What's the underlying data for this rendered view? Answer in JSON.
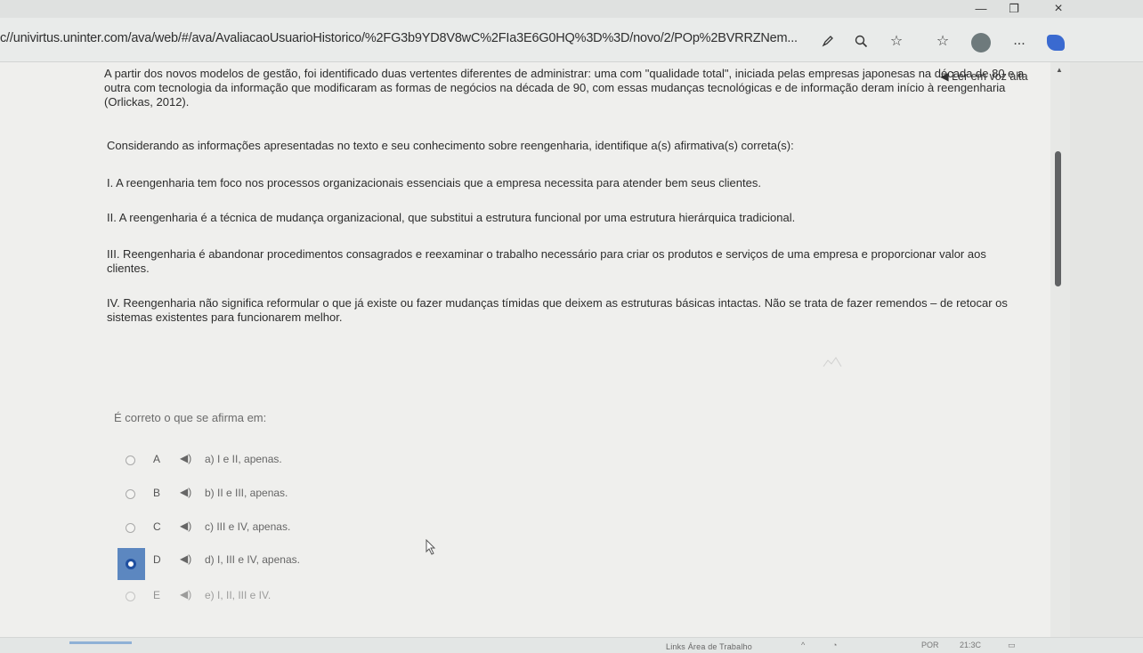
{
  "browser": {
    "url": "c//univirtus.uninter.com/ava/web/#/ava/AvaliacaoUsuarioHistorico/%2FG3b9YD8V8wC%2FIa3E6G0HQ%3D%3D/novo/2/POp%2BVRRZNem...",
    "icons": [
      "pen-icon",
      "zoom-icon",
      "favorite-star-icon",
      "favorites-list-icon",
      "profile-avatar",
      "more-icon",
      "extension-icon"
    ],
    "more_label": "..."
  },
  "tts_label": "◀ Ler em voz alta",
  "question": {
    "intro": "A partir dos novos modelos de gestão, foi identificado duas vertentes diferentes de administrar: uma com \"qualidade total\", iniciada pelas empresas japonesas na década de 80 e a outra com tecnologia da informação que modificaram as formas de negócios na década de 90, com essas mudanças tecnológicas e de informação deram início à reengenharia (Orlickas, 2012).",
    "prompt": "Considerando as informações apresentadas no texto e seu conhecimento sobre reengenharia, identifique a(s) afirmativa(s) correta(s):",
    "statements": [
      "I. A reengenharia tem foco nos processos organizacionais essenciais que a empresa necessita para atender bem seus clientes.",
      "II. A reengenharia é a técnica de mudança organizacional, que substitui a estrutura funcional por uma estrutura hierárquica tradicional.",
      "III. Reengenharia é abandonar procedimentos consagrados e reexaminar o trabalho necessário para criar os produtos e serviços de uma empresa e proporcionar valor aos clientes.",
      "IV. Reengenharia não significa reformular o que já existe ou fazer mudanças tímidas que deixem as estruturas básicas intactas. Não se trata de fazer remendos – de retocar os sistemas existentes para funcionarem melhor."
    ],
    "lead": "É correto o que se afirma em:"
  },
  "options": [
    {
      "letter": "A",
      "text": "a) I e II, apenas.",
      "selected": false
    },
    {
      "letter": "B",
      "text": "b) II e III, apenas.",
      "selected": false
    },
    {
      "letter": "C",
      "text": "c) III e IV, apenas.",
      "selected": false
    },
    {
      "letter": "D",
      "text": "d) I, III e IV, apenas.",
      "selected": true
    },
    {
      "letter": "E",
      "text": "e) I, II, III e IV.",
      "selected": false
    }
  ],
  "taskbar": {
    "links_label": "Links   Área de Trabalho",
    "lang": "POR",
    "time": "21:3C"
  },
  "colors": {
    "selected_option_bg": "#5c87c0",
    "page_bg": "#efefed",
    "scroll_thumb": "#606264"
  }
}
